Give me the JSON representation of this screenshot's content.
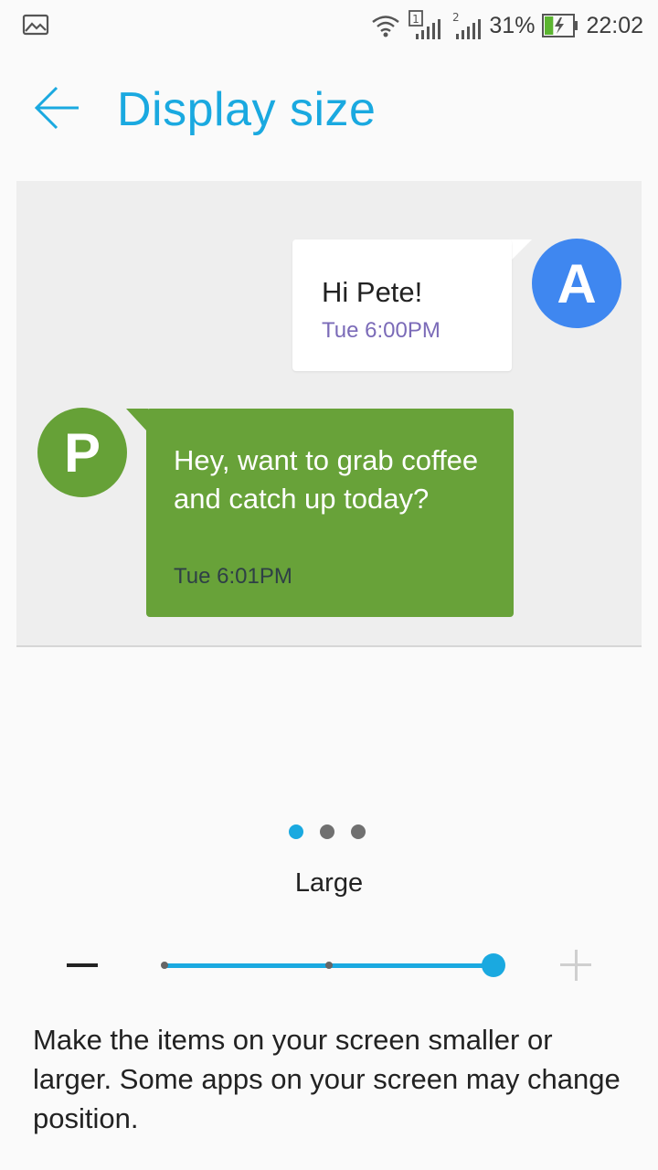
{
  "status_bar": {
    "battery_percent": "31%",
    "time": "22:02",
    "sim1_label": "1",
    "sim2_label": "2",
    "battery_level": 0.31
  },
  "header": {
    "title": "Display size"
  },
  "preview": {
    "outgoing": {
      "avatar_letter": "A",
      "text": "Hi Pete!",
      "time": "Tue 6:00PM",
      "bubble_color": "#ffffff",
      "avatar_color": "#3f87f0"
    },
    "incoming": {
      "avatar_letter": "P",
      "text": "Hey, want to grab coffee and catch up today?",
      "time": "Tue 6:01PM",
      "bubble_color": "#68a239",
      "avatar_color": "#66a137"
    }
  },
  "pager": {
    "count": 3,
    "active_index": 0
  },
  "size": {
    "label": "Large",
    "steps": 3,
    "current_step": 3
  },
  "description": "Make the items on your screen smaller or larger. Some apps on your screen may change position.",
  "colors": {
    "accent": "#1aa9e0"
  }
}
